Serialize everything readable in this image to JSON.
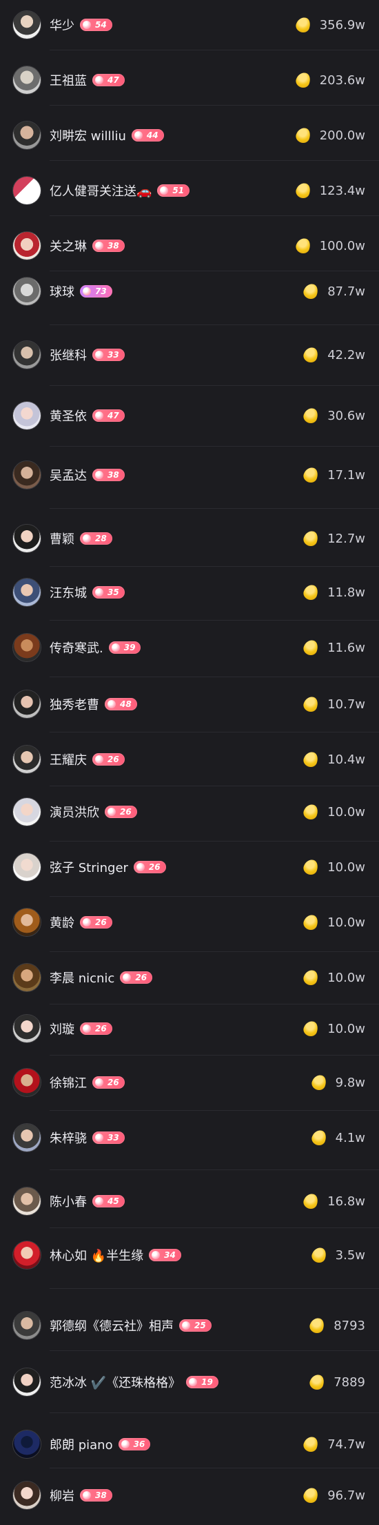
{
  "colors": {
    "background": "#1c1c20",
    "badge_gradient": [
      "#ff7a8f",
      "#ff5d7a"
    ],
    "badge_purple_gradient": [
      "#c783ff",
      "#ff6fb7"
    ],
    "coin": "#f5c518"
  },
  "coin_icon": "gold-bean-icon",
  "rows": [
    {
      "name": "华少",
      "level": "54",
      "amount": "356.9w"
    },
    {
      "name": "王祖蓝",
      "level": "47",
      "amount": "203.6w"
    },
    {
      "name": "刘畊宏 willliu",
      "level": "44",
      "amount": "200.0w"
    },
    {
      "name": "亿人健哥关注送🚗",
      "level": "51",
      "amount": "123.4w"
    },
    {
      "name": "关之琳",
      "level": "38",
      "amount": "100.0w"
    },
    {
      "name": "球球",
      "level": "73",
      "amount": "87.7w"
    },
    {
      "name": "张继科",
      "level": "33",
      "amount": "42.2w"
    },
    {
      "name": "黄圣依",
      "level": "47",
      "amount": "30.6w"
    },
    {
      "name": "吴孟达",
      "level": "38",
      "amount": "17.1w"
    },
    {
      "name": "曹颖",
      "level": "28",
      "amount": "12.7w"
    },
    {
      "name": "汪东城",
      "level": "35",
      "amount": "11.8w"
    },
    {
      "name": "传奇寒武.",
      "level": "39",
      "amount": "11.6w"
    },
    {
      "name": "独秀老曹",
      "level": "48",
      "amount": "10.7w"
    },
    {
      "name": "王耀庆",
      "level": "26",
      "amount": "10.4w"
    },
    {
      "name": "演员洪欣",
      "level": "26",
      "amount": "10.0w"
    },
    {
      "name": "弦子 Stringer",
      "level": "26",
      "amount": "10.0w"
    },
    {
      "name": "黄龄",
      "level": "26",
      "amount": "10.0w"
    },
    {
      "name": "李晨 nicnic",
      "level": "26",
      "amount": "10.0w"
    },
    {
      "name": "刘璇",
      "level": "26",
      "amount": "10.0w"
    },
    {
      "name": "徐锦江",
      "level": "26",
      "amount": "9.8w"
    },
    {
      "name": "朱梓骁",
      "level": "33",
      "amount": "4.1w"
    },
    {
      "name": "陈小春",
      "level": "45",
      "amount": "16.8w"
    },
    {
      "name": "林心如 🔥半生缘",
      "level": "34",
      "amount": "3.5w"
    },
    {
      "name": "郭德纲《德云社》相声",
      "level": "25",
      "amount": "8793"
    },
    {
      "name": "范冰冰 ✔️《还珠格格》",
      "level": "19",
      "amount": "7889"
    },
    {
      "name": "郎朗 piano",
      "level": "36",
      "amount": "74.7w"
    },
    {
      "name": "柳岩",
      "level": "38",
      "amount": "96.7w"
    }
  ]
}
